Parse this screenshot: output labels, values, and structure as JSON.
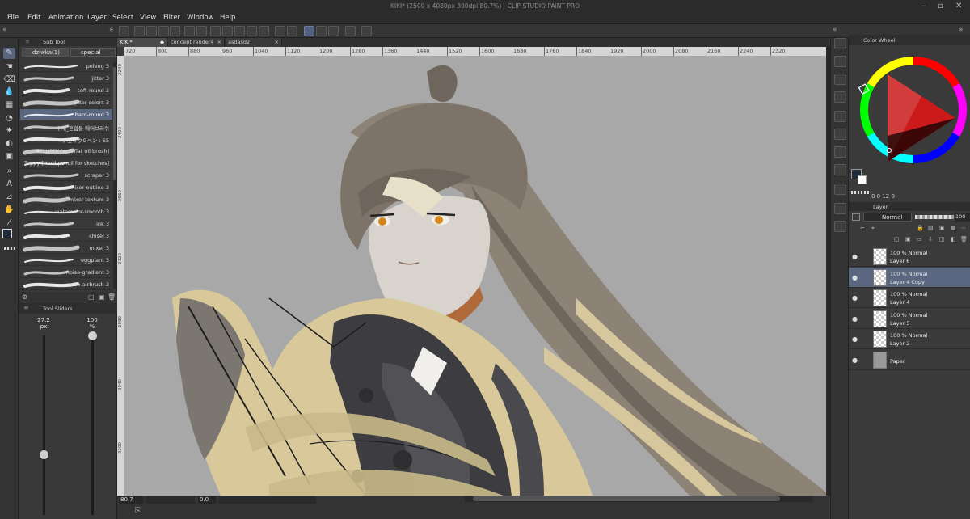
{
  "window": {
    "title": "KIKI* (2500 x 4080px 300dpi 80.7%)  - CLIP STUDIO PAINT PRO"
  },
  "menu": [
    "File",
    "Edit",
    "Animation",
    "Layer",
    "Select",
    "View",
    "Filter",
    "Window",
    "Help"
  ],
  "subtool": {
    "panel_title": "Sub Tool",
    "tabs": [
      "dziwka(1)",
      "special"
    ],
    "brushes": [
      {
        "label": "peleng 3"
      },
      {
        "label": "jitter 3"
      },
      {
        "label": "soft-round 3"
      },
      {
        "label": "jitter-colors 3"
      },
      {
        "label": "hard-round 3"
      },
      {
        "label": "수채_혼합물 에어브러쉬"
      },
      {
        "label": "フェイクGペン : S5"
      },
      {
        "label": "✚FLUPPY [soft flat oil brush]"
      },
      {
        "label": "Tuppy [Hard pencil for sketches]"
      },
      {
        "label": "scraper 3"
      },
      {
        "label": "mixer-outline 3"
      },
      {
        "label": "mixer-texture 3"
      },
      {
        "label": "watercolor-smooth 3"
      },
      {
        "label": "ink 3"
      },
      {
        "label": "chisel 3"
      },
      {
        "label": "mixer 3"
      },
      {
        "label": "eggplant 3"
      },
      {
        "label": "noise-gradient 3"
      },
      {
        "label": "noise-airbrush 3"
      }
    ],
    "selected_index": 4
  },
  "tool_sliders": {
    "panel_title": "Tool Sliders",
    "size_value": "27.2",
    "size_unit": "px",
    "opacity_value": "100",
    "opacity_unit": "%",
    "size_level": 0.34,
    "opacity_level": 1.0
  },
  "doc_tabs": [
    "KIKI*",
    "concept render4",
    "asdasd2"
  ],
  "ruler_top": [
    "720",
    "800",
    "880",
    "960",
    "1040",
    "1120",
    "1200",
    "1280",
    "1360",
    "1440",
    "1520",
    "1600",
    "1680",
    "1760",
    "1840",
    "1920",
    "2000",
    "2080",
    "2160",
    "2240",
    "2320"
  ],
  "ruler_left": [
    "2240",
    "2400",
    "2560",
    "2720",
    "2880",
    "3040",
    "3200"
  ],
  "status": {
    "zoom": "80.7",
    "angle": "0.0"
  },
  "color_wheel": {
    "panel_title": "Color Wheel",
    "readout": "0  0  12  0",
    "main_color": "#1e2a38",
    "sub_color": "#ffffff"
  },
  "layers": {
    "panel_title": "Layer",
    "blend_mode": "Normal",
    "opacity": "100",
    "items": [
      {
        "blend": "100 % Normal",
        "name": "Layer 6"
      },
      {
        "blend": "100 % Normal",
        "name": "Layer 4 Copy"
      },
      {
        "blend": "100 % Normal",
        "name": "Layer 4"
      },
      {
        "blend": "100 % Normal",
        "name": "Layer 5"
      },
      {
        "blend": "100 % Normal",
        "name": "Layer 2"
      },
      {
        "blend": "",
        "name": "Paper"
      }
    ],
    "selected_index": 1
  },
  "colors": {
    "selection": "#5b6780",
    "canvas_bg": "#a8a8a8",
    "cream": "#d9c99a",
    "hair": "#7a7066",
    "dark": "#3a3a3c"
  }
}
